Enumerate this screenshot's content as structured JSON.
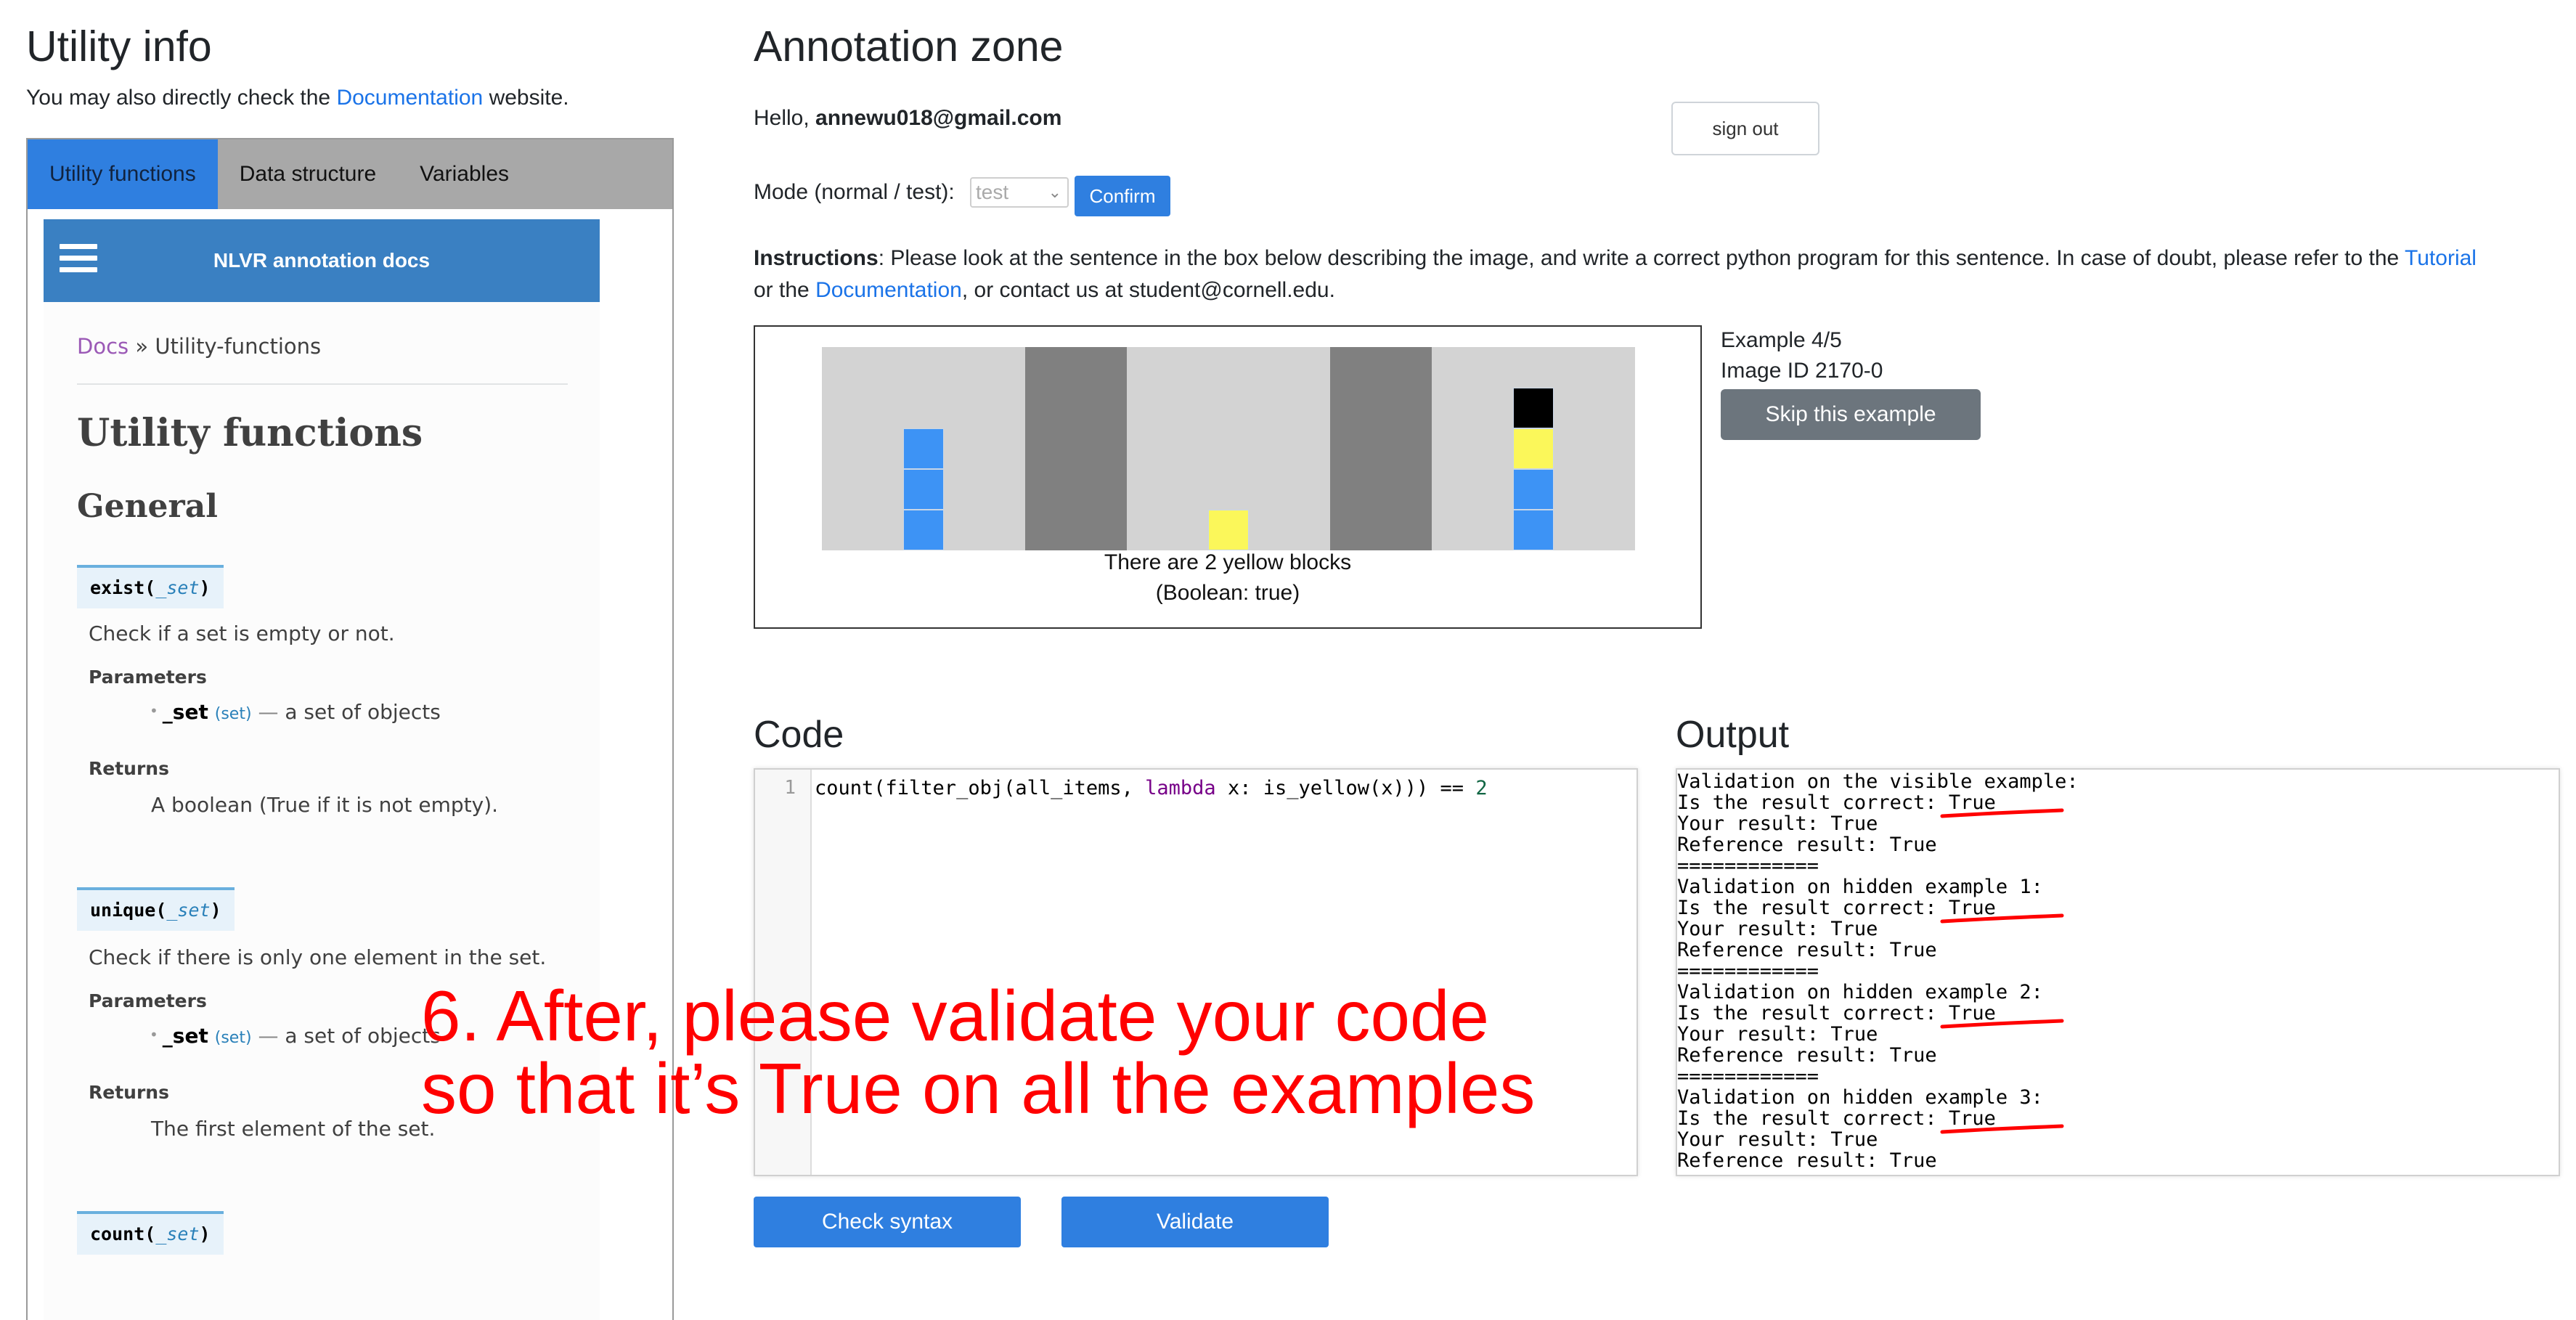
{
  "left": {
    "title": "Utility info",
    "subtitle_prefix": "You may also directly check the ",
    "subtitle_link": "Documentation",
    "subtitle_suffix": " website.",
    "tabs": [
      {
        "label": "Utility functions",
        "active": true
      },
      {
        "label": "Data structure",
        "active": false
      },
      {
        "label": "Variables",
        "active": false
      }
    ],
    "docs": {
      "header_title": "NLVR annotation docs",
      "breadcrumb_link": "Docs",
      "breadcrumb_sep": "»",
      "breadcrumb_current": "Utility-functions",
      "h1": "Utility functions",
      "h2": "General",
      "functions": [
        {
          "name": "exist",
          "arg": "_set",
          "description": "Check if a set is empty or not.",
          "params_label": "Parameters",
          "param_name": "_set",
          "param_type": "(set)",
          "param_desc": "a set of objects",
          "returns_label": "Returns",
          "returns": "A boolean (True if it is not empty)."
        },
        {
          "name": "unique",
          "arg": "_set",
          "description": "Check if there is only one element in the set.",
          "params_label": "Parameters",
          "param_name": "_set",
          "param_type": "(set)",
          "param_desc": "a set of objects",
          "returns_label": "Returns",
          "returns": "The first element of the set."
        },
        {
          "name": "count",
          "arg": "_set"
        }
      ]
    }
  },
  "right": {
    "title": "Annotation zone",
    "hello_prefix": "Hello, ",
    "user_email": "annewu018@gmail.com",
    "sign_out": "sign out",
    "mode_label": "Mode (normal / test):",
    "mode_value": "test",
    "confirm": "Confirm",
    "instructions_label": "Instructions",
    "instructions_text": ": Please look at the sentence in the box below describing the image, and write a correct python program for this sentence. In case of doubt, please refer to the ",
    "instructions_link1": "Tutorial",
    "instructions_mid": "or the ",
    "instructions_link2": "Documentation",
    "instructions_end": ", or contact us at student@cornell.edu.",
    "example": {
      "sentence": "There are 2 yellow blocks",
      "label": "(Boolean: true)",
      "counter": "Example 4/5",
      "image_id": "Image ID 2170-0",
      "skip": "Skip this example",
      "colors": {
        "blue": "#3d93f5",
        "yellow": "#fbf75a",
        "black": "#000000",
        "gray": "#808080",
        "background": "#d3d3d3"
      },
      "scene_columns": [
        [
          "blue",
          "blue",
          "blue"
        ],
        [
          "yellow"
        ],
        [
          "blue",
          "blue",
          "yellow",
          "black"
        ]
      ]
    },
    "code_title": "Code",
    "output_title": "Output",
    "code": {
      "line_number": "1",
      "pre": "count(filter_obj(all_items, ",
      "keyword": "lambda",
      "mid": " x: is_yellow(x))) == ",
      "number": "2"
    },
    "output_lines": [
      "Validation on the visible example:",
      "Is the result correct: True",
      "Your result: True",
      "Reference result: True",
      "============",
      "Validation on hidden example 1:",
      "Is the result correct: True",
      "Your result: True",
      "Reference result: True",
      "============",
      "Validation on hidden example 2:",
      "Is the result correct: True",
      "Your result: True",
      "Reference result: True",
      "============",
      "Validation on hidden example 3:",
      "Is the result correct: True",
      "Your result: True",
      "Reference result: True"
    ],
    "check_syntax": "Check syntax",
    "validate": "Validate"
  },
  "overlay": {
    "line1": "6. After, please validate your code",
    "line2": "so that it’s True on all the examples",
    "color": "#ff0000"
  }
}
